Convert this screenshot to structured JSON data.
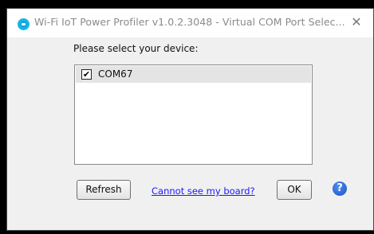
{
  "window": {
    "title": "Wi-Fi IoT Power Profiler v1.0.2.3048 - Virtual COM Port Selec...",
    "close_glyph": "✕"
  },
  "prompt": "Please select your device:",
  "devices": [
    {
      "label": "COM67",
      "checked": true,
      "check_glyph": "✔"
    }
  ],
  "buttons": {
    "refresh": "Refresh",
    "ok": "OK"
  },
  "links": {
    "cannot_see_board": "Cannot see my board?"
  },
  "help": {
    "glyph": "?"
  },
  "colors": {
    "link": "#1a1aff",
    "help_icon": "#1c52c4",
    "app_icon": "#10a6d6",
    "list_selection": "#e4e4e4"
  }
}
